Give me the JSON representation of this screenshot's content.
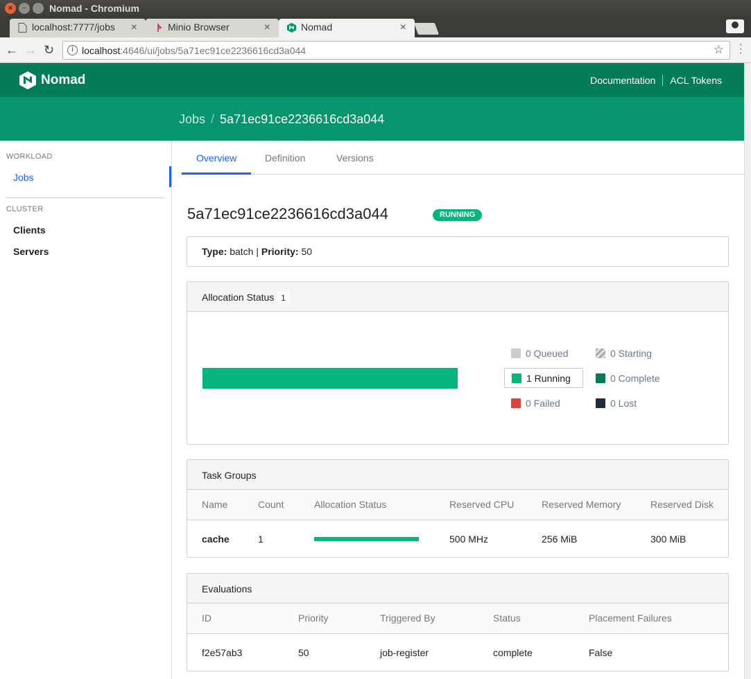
{
  "window": {
    "title": "Nomad - Chromium"
  },
  "tabs": [
    {
      "label": "localhost:7777/jobs",
      "active": false
    },
    {
      "label": "Minio Browser",
      "active": false
    },
    {
      "label": "Nomad",
      "active": true
    }
  ],
  "address": {
    "host": "localhost",
    "path": ":4646/ui/jobs/5a71ec91ce2236616cd3a044"
  },
  "header": {
    "brand": "Nomad",
    "links": [
      "Documentation",
      "ACL Tokens"
    ],
    "breadcrumb": {
      "parent": "Jobs",
      "current": "5a71ec91ce2236616cd3a044"
    }
  },
  "sidebar": {
    "workload_label": "WORKLOAD",
    "workload_items": [
      "Jobs"
    ],
    "cluster_label": "CLUSTER",
    "cluster_items": [
      "Clients",
      "Servers"
    ]
  },
  "main_tabs": [
    "Overview",
    "Definition",
    "Versions"
  ],
  "job": {
    "name": "5a71ec91ce2236616cd3a044",
    "status": "RUNNING",
    "type_label": "Type:",
    "type": "batch",
    "priority_label": "Priority:",
    "priority": "50"
  },
  "allocation_status": {
    "title": "Allocation Status",
    "count": "1",
    "legend": {
      "queued": "0 Queued",
      "starting": "0 Starting",
      "running": "1 Running",
      "complete": "0 Complete",
      "failed": "0 Failed",
      "lost": "0 Lost"
    },
    "running_fraction": 1.0
  },
  "task_groups": {
    "title": "Task Groups",
    "columns": [
      "Name",
      "Count",
      "Allocation Status",
      "Reserved CPU",
      "Reserved Memory",
      "Reserved Disk"
    ],
    "rows": [
      {
        "name": "cache",
        "count": "1",
        "cpu": "500 MHz",
        "memory": "256 MiB",
        "disk": "300 MiB"
      }
    ]
  },
  "evaluations": {
    "title": "Evaluations",
    "columns": [
      "ID",
      "Priority",
      "Triggered By",
      "Status",
      "Placement Failures"
    ],
    "rows": [
      {
        "id": "f2e57ab3",
        "priority": "50",
        "triggered_by": "job-register",
        "status": "complete",
        "placement_failures": "False"
      }
    ]
  },
  "colors": {
    "brand_dark": "#047b59",
    "brand": "#06956c",
    "running": "#06b57e",
    "queued": "#cccccc",
    "complete": "#047b59",
    "failed": "#d9453a",
    "lost": "#1f2d3d",
    "link": "#1563ff"
  }
}
